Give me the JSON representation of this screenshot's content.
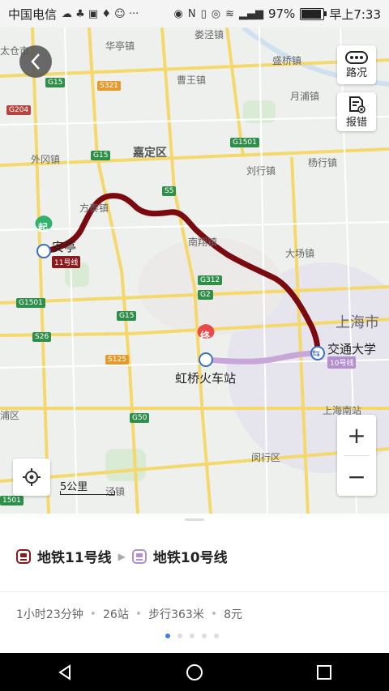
{
  "status": {
    "carrier": "中国电信",
    "battery_text": "97%",
    "battery_level": 0.97,
    "time": "早上7:33"
  },
  "map": {
    "places": {
      "taicang": "太仓市",
      "huating": "华亭镇",
      "loujing": "娄泾镇",
      "shengqiao": "盛桥镇",
      "caowang": "曹王镇",
      "yuepu": "月浦镇",
      "waigang": "外冈镇",
      "jiading": "嘉定区",
      "liuhang": "刘行镇",
      "yanghang": "杨行镇",
      "fangtai": "方泰镇",
      "nanxiang": "南翔镇",
      "dachang": "大场镇",
      "anting": "安亭",
      "shanghai": "上海市",
      "jiaotong": "交通大学",
      "hongqiao": "虹桥火车站",
      "qingpu": "浦区",
      "minhang": "闵行区",
      "shanghai_south": "上海南站",
      "jingzhen": "泾镇"
    },
    "highways": {
      "g15a": "G15",
      "s321": "S321",
      "g204": "G204",
      "g15b": "G15",
      "g1501a": "G1501",
      "s5": "S5",
      "g312": "G312",
      "g2": "G2",
      "g1501b": "G1501",
      "s26": "S26",
      "g15c": "G15",
      "s125": "S125",
      "g50": "G50",
      "g1501c": "1501"
    },
    "line11_tag": "11号线",
    "line10_tag": "10号线",
    "start_marker": "起",
    "end_marker": "终",
    "route_colors": {
      "line11": "#7a0a0f",
      "line10": "#c8a6d8"
    },
    "scale_label": "5公里"
  },
  "controls": {
    "traffic_label": "路况",
    "report_label": "报错",
    "zoom_in": "+",
    "zoom_out": "−"
  },
  "route": {
    "line1": "地铁11号线",
    "line2": "地铁10号线",
    "line1_color": "#8b1a1f",
    "line2_color": "#b48fcf",
    "duration": "1小时23分钟",
    "stops": "26站",
    "walk": "步行363米",
    "fare": "8元",
    "sep": "•"
  }
}
